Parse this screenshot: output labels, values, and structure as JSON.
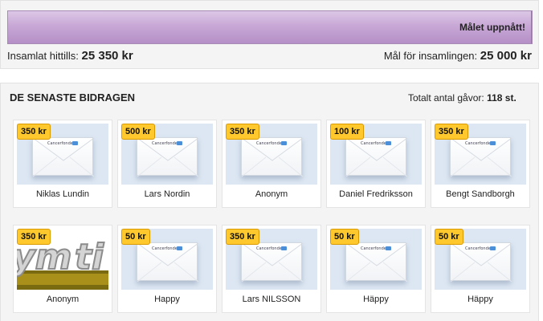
{
  "progress": {
    "fraction": 1.0,
    "message": "Målet uppnått!",
    "raised_label": "Insamlat hittills:",
    "raised_value": "25 350 kr",
    "goal_label": "Mål för insamlingen:",
    "goal_value": "25 000 kr",
    "bar_color": "#c8a8d6"
  },
  "contributions": {
    "title": "DE SENASTE BIDRAGEN",
    "total_label": "Totalt antal gåvor:",
    "total_value": "118 st.",
    "envelope_brand": "Cancerfonden",
    "badge_color": "#ffc92e",
    "items": [
      {
        "amount": "350 kr",
        "name": "Niklas Lundin",
        "image": "envelope"
      },
      {
        "amount": "500 kr",
        "name": "Lars Nordin",
        "image": "envelope"
      },
      {
        "amount": "350 kr",
        "name": "Anonym",
        "image": "envelope"
      },
      {
        "amount": "100 kr",
        "name": "Daniel Fredriksson",
        "image": "envelope"
      },
      {
        "amount": "350 kr",
        "name": "Bengt Sandborgh",
        "image": "envelope"
      },
      {
        "amount": "350 kr",
        "name": "Anonym",
        "image": "anonym-graphic"
      },
      {
        "amount": "50 kr",
        "name": "Happy",
        "image": "envelope"
      },
      {
        "amount": "350 kr",
        "name": "Lars NILSSON",
        "image": "envelope"
      },
      {
        "amount": "50 kr",
        "name": "Häppy",
        "image": "envelope"
      },
      {
        "amount": "50 kr",
        "name": "Häppy",
        "image": "envelope"
      }
    ]
  }
}
